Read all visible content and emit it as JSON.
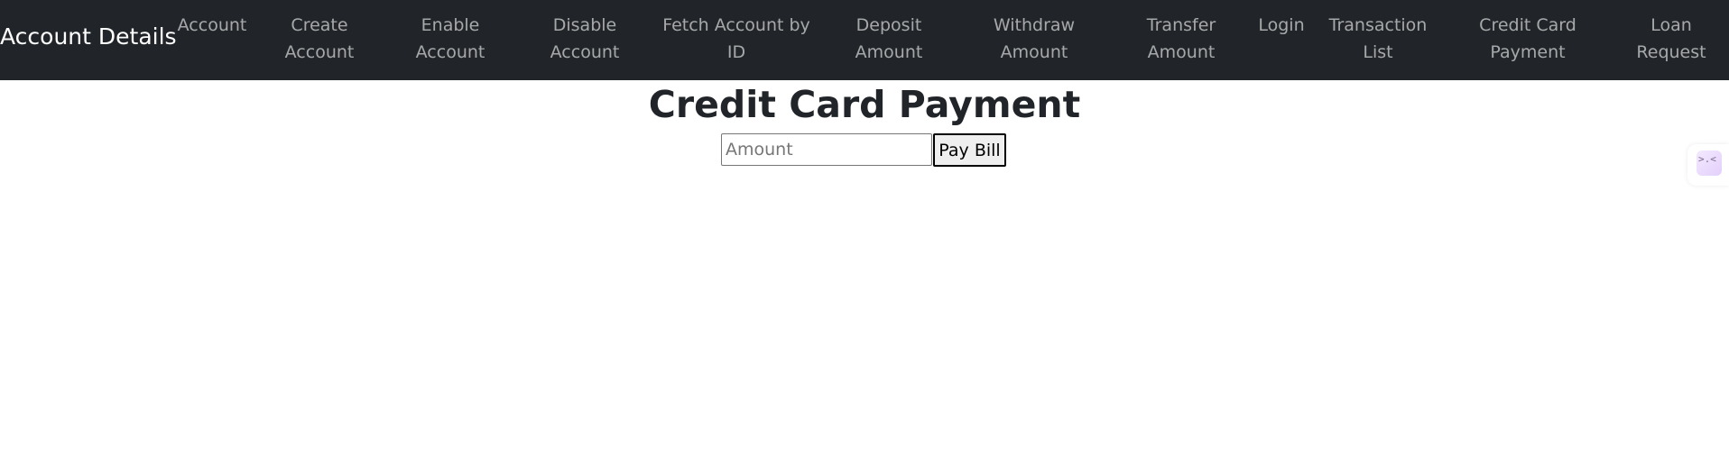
{
  "navbar": {
    "brand": "Account Details",
    "items": [
      {
        "label": "Account"
      },
      {
        "label": "Create\nAccount"
      },
      {
        "label": "Enable\nAccount"
      },
      {
        "label": "Disable\nAccount"
      },
      {
        "label": "Fetch Account by\nID"
      },
      {
        "label": "Deposit\nAmount"
      },
      {
        "label": "Withdraw\nAmount"
      },
      {
        "label": "Transfer\nAmount"
      },
      {
        "label": "Login"
      },
      {
        "label": "Transaction\nList"
      },
      {
        "label": "Credit Card\nPayment"
      },
      {
        "label": "Loan\nRequest"
      }
    ]
  },
  "main": {
    "title": "Credit Card Payment",
    "amount_input": {
      "placeholder": "Amount",
      "value": ""
    },
    "pay_button_label": "Pay Bill"
  },
  "side_widget": {
    "icon": "translate-icon",
    "glyph": ">.<"
  },
  "colors": {
    "navbar_bg": "#212529",
    "nav_text": "#9b9ea0",
    "brand_text": "#ffffff",
    "title_text": "#212529"
  }
}
